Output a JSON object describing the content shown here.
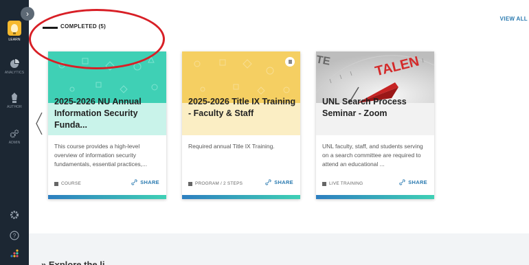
{
  "sidebar": {
    "toggle_glyph": "›",
    "items": [
      {
        "label": "LEARN",
        "icon": "lightbulb-icon"
      },
      {
        "label": "ANALYTICS",
        "icon": "analytics-icon"
      },
      {
        "label": "AUTHOR",
        "icon": "author-icon"
      },
      {
        "label": "ADMIN",
        "icon": "admin-gears-icon"
      }
    ],
    "bottom_icons": [
      "settings-gear-icon",
      "help-icon",
      "apps-grid-icon"
    ]
  },
  "section": {
    "completed_label": "COMPLETED (5)",
    "view_all": "VIEW ALL"
  },
  "cards": [
    {
      "title": "2025-2026 NU Annual Information Security Funda...",
      "description": "This course provides a high-level overview of information security fundamentals, essential practices,...",
      "type": "COURSE",
      "share": "SHARE",
      "header_color": "#3fd0b5",
      "title_bg": "#c9f3ea"
    },
    {
      "title": "2025-2026 Title IX Training - Faculty & Staff",
      "description": "Required annual Title IX Training.",
      "type": "PROGRAM / 2 STEPS",
      "share": "SHARE",
      "header_color": "#f5cf62",
      "title_bg": "#fbeec4"
    },
    {
      "title": "UNL Search Process Seminar - Zoom",
      "description": "UNL faculty, staff, and students serving on a search committee are required to attend an educational ...",
      "type": "LIVE TRAINING",
      "share": "SHARE",
      "header_color": "#d9d9d9",
      "title_bg": "#f2f2f2"
    }
  ],
  "image_text": {
    "compass_word": "TALEN",
    "compass_word_left": "TE"
  },
  "bottom": {
    "explore_label": "» Explore the li..."
  },
  "colors": {
    "sidebar_bg": "#1c2733",
    "accent_blue": "#2a7ab0",
    "progress_start": "#2d7fc0",
    "progress_end": "#3fd0b5",
    "highlight_red": "#d81f26"
  }
}
